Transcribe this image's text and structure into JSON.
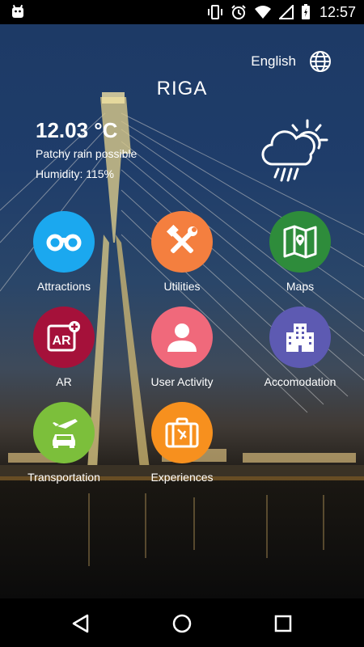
{
  "status_bar": {
    "time": "12:57"
  },
  "header": {
    "language": "English",
    "city": "RIGA"
  },
  "weather": {
    "temperature": "12.03 °C",
    "condition": "Patchy rain possible",
    "humidity": "Humidity: 115%"
  },
  "tiles": [
    {
      "label": "Attractions",
      "color": "#1ba8ef",
      "icon": "binoculars-icon"
    },
    {
      "label": "Utilities",
      "color": "#f47f3f",
      "icon": "tools-icon"
    },
    {
      "label": "Maps",
      "color": "#2e8c3b",
      "icon": "map-icon"
    },
    {
      "label": "AR",
      "color": "#a5113a",
      "icon": "ar-icon"
    },
    {
      "label": "User Activity",
      "color": "#f0697b",
      "icon": "user-icon"
    },
    {
      "label": "Accomodation",
      "color": "#5d5ab2",
      "icon": "building-icon"
    },
    {
      "label": "Transportation",
      "color": "#7cbf3b",
      "icon": "transport-icon"
    },
    {
      "label": "Experiences",
      "color": "#f7901e",
      "icon": "suitcase-icon"
    }
  ]
}
